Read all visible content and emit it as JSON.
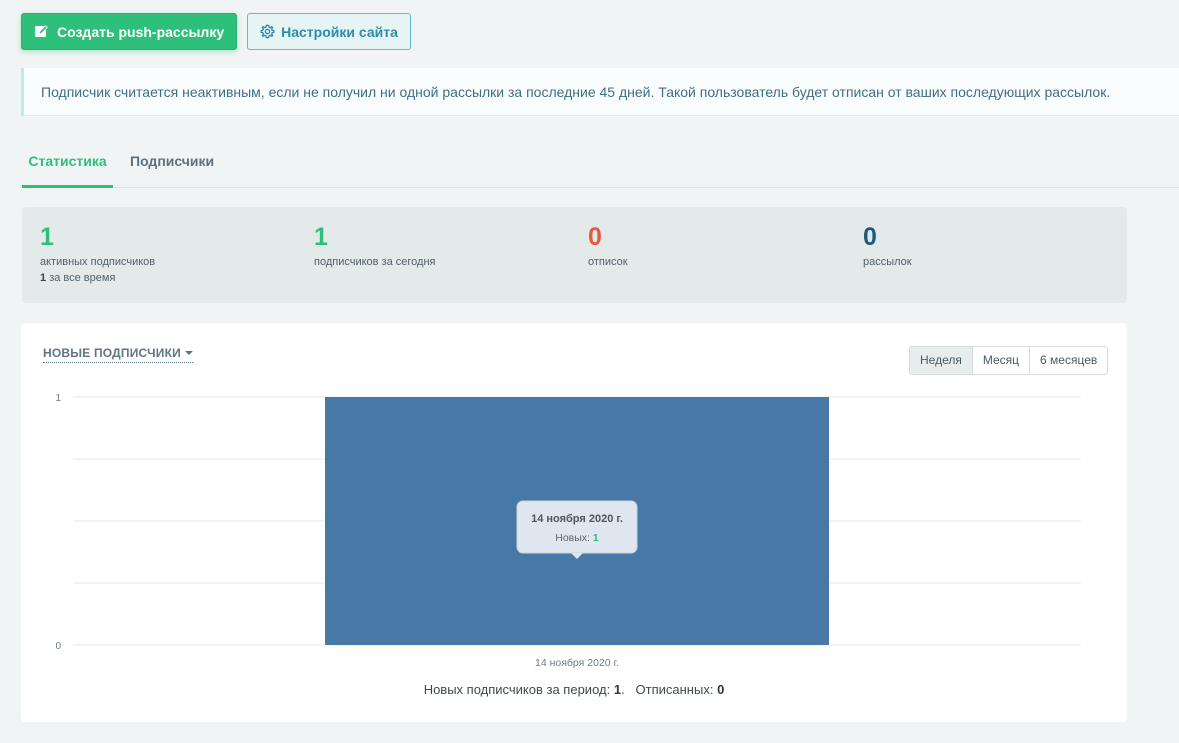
{
  "toolbar": {
    "create_label": "Создать push-рассылку",
    "settings_label": "Настройки сайта"
  },
  "alert": {
    "text": "Подписчик считается неактивным, если не получил ни одной рассылки за последние 45 дней. Такой пользователь будет отписан от ваших последующих рассылок."
  },
  "tabs": [
    {
      "label": "Статистика",
      "active": true
    },
    {
      "label": "Подписчики",
      "active": false
    }
  ],
  "stats": {
    "active": {
      "value": "1",
      "label": "активных подписчиков",
      "sub_value": "1",
      "sub_label": "за все время"
    },
    "today": {
      "value": "1",
      "label": "подписчиков за сегодня"
    },
    "unsub": {
      "value": "0",
      "label": "отписок"
    },
    "mailings": {
      "value": "0",
      "label": "рассылок"
    }
  },
  "colors": {
    "green": "#2ec07a",
    "red": "#e35b3c",
    "navy": "#1e5a80",
    "bar": "#4879a6"
  },
  "chart_section": {
    "select_label": "НОВЫЕ ПОДПИСЧИКИ",
    "periods": [
      "Неделя",
      "Месяц",
      "6 месяцев"
    ],
    "active_period": "Неделя",
    "tooltip": {
      "title": "14 ноября 2020 г.",
      "label": "Новых:",
      "value": "1"
    },
    "summary": {
      "new_label": "Новых подписчиков за период:",
      "new_value": "1",
      "unsub_label": "Отписанных:",
      "unsub_value": "0"
    }
  },
  "chart_data": {
    "type": "bar",
    "categories": [
      "14 ноября 2020 г."
    ],
    "values": [
      1
    ],
    "ylim": [
      0,
      1
    ],
    "yticks": [
      0,
      1
    ],
    "grid": true
  }
}
